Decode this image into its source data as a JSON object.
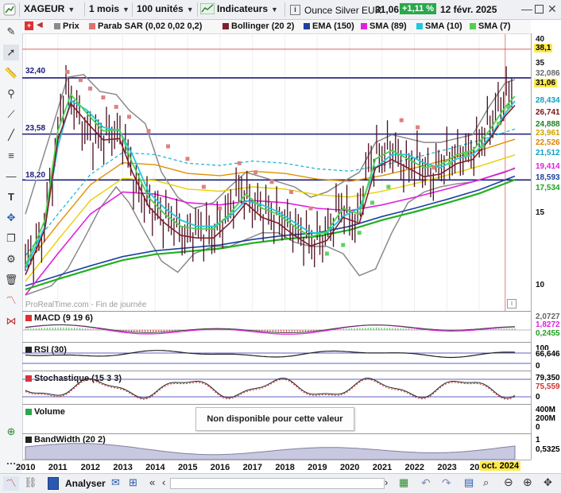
{
  "topbar": {
    "symbol": "XAGEUR",
    "period": "1 mois",
    "units": "100 unités",
    "indicators_label": "Indicateurs",
    "instrument_name": "Ounce Silver EUR",
    "last_price": "31,06",
    "change_pct": "+1,11 %",
    "date": "12 févr. 2025"
  },
  "legend": [
    {
      "label": "Prix",
      "color": "#8b8b8b"
    },
    {
      "label": "Parab SAR (0,02 0,02 0,2)",
      "color": "#e07070"
    },
    {
      "label": "Bollinger (20 2)",
      "color": "#7f1f2f"
    },
    {
      "label": "EMA (150)",
      "color": "#1f3fa0"
    },
    {
      "label": "SMA (89)",
      "color": "#e020e0"
    },
    {
      "label": "SMA (10)",
      "color": "#20c8e0"
    },
    {
      "label": "SMA (7)",
      "color": "#50d050"
    }
  ],
  "chart_data": {
    "type": "line",
    "title": "",
    "x_range": [
      2010,
      2025.1
    ],
    "y_scale": "log",
    "ylim": [
      9,
      40
    ],
    "years": [
      "2010",
      "2011",
      "2012",
      "2013",
      "2014",
      "2015",
      "2016",
      "2017",
      "2018",
      "2019",
      "2020",
      "2021",
      "2022",
      "2023",
      "2024"
    ],
    "y_ticks": [
      "40",
      "35",
      "15",
      "10"
    ],
    "price_levels": [
      {
        "label": "32,40",
        "value": 32.4,
        "color": "#1a1a7a"
      },
      {
        "label": "23,58",
        "value": 23.58,
        "color": "#1a1a7a"
      },
      {
        "label": "18,20",
        "value": 18.2,
        "color": "#1a1a7a"
      }
    ],
    "right_labels": [
      {
        "text": "38,1",
        "bg": "#ffe94d",
        "fg": "#000000"
      },
      {
        "text": "32,086",
        "bg": "#ffffff",
        "fg": "#666666"
      },
      {
        "text": "31,06",
        "bg": "#ffe94d",
        "fg": "#000000"
      },
      {
        "text": "28,434",
        "bg": "#ffffff",
        "fg": "#10a0c0"
      },
      {
        "text": "26,741",
        "bg": "#ffffff",
        "fg": "#7a1010"
      },
      {
        "text": "24,888",
        "bg": "#ffffff",
        "fg": "#208020"
      },
      {
        "text": "23,961",
        "bg": "#ffffff",
        "fg": "#d0a000"
      },
      {
        "text": "22,526",
        "bg": "#ffffff",
        "fg": "#e08000"
      },
      {
        "text": "21,512",
        "bg": "#ffffff",
        "fg": "#10a0c0"
      },
      {
        "text": "19,414",
        "bg": "#ffffff",
        "fg": "#e020e0"
      },
      {
        "text": "18,593",
        "bg": "#ffffff",
        "fg": "#1f3fa0"
      },
      {
        "text": "17,534",
        "bg": "#ffffff",
        "fg": "#20a020"
      }
    ],
    "price_close": [
      [
        2010.0,
        11.5
      ],
      [
        2010.5,
        13.0
      ],
      [
        2010.9,
        20.0
      ],
      [
        2011.2,
        31.0
      ],
      [
        2011.5,
        28.0
      ],
      [
        2011.8,
        24.5
      ],
      [
        2012.2,
        23.0
      ],
      [
        2012.6,
        24.0
      ],
      [
        2013.0,
        23.5
      ],
      [
        2013.4,
        17.5
      ],
      [
        2013.8,
        16.0
      ],
      [
        2014.2,
        15.0
      ],
      [
        2014.6,
        14.5
      ],
      [
        2014.9,
        13.2
      ],
      [
        2015.3,
        14.0
      ],
      [
        2015.8,
        13.5
      ],
      [
        2016.2,
        15.0
      ],
      [
        2016.6,
        17.5
      ],
      [
        2017.0,
        16.0
      ],
      [
        2017.5,
        15.2
      ],
      [
        2018.0,
        14.5
      ],
      [
        2018.5,
        13.5
      ],
      [
        2018.9,
        12.8
      ],
      [
        2019.3,
        13.5
      ],
      [
        2019.7,
        16.0
      ],
      [
        2020.2,
        14.0
      ],
      [
        2020.6,
        20.5
      ],
      [
        2020.9,
        21.0
      ],
      [
        2021.3,
        22.0
      ],
      [
        2021.7,
        19.5
      ],
      [
        2022.1,
        20.5
      ],
      [
        2022.5,
        18.5
      ],
      [
        2022.9,
        20.5
      ],
      [
        2023.3,
        21.0
      ],
      [
        2023.8,
        21.5
      ],
      [
        2024.2,
        24.0
      ],
      [
        2024.5,
        27.0
      ],
      [
        2024.8,
        29.5
      ],
      [
        2025.1,
        31.06
      ]
    ],
    "bollinger_upper": [
      [
        2010.0,
        15.0
      ],
      [
        2010.8,
        24.0
      ],
      [
        2011.3,
        32.5
      ],
      [
        2011.8,
        33.0
      ],
      [
        2012.3,
        30.0
      ],
      [
        2012.8,
        29.5
      ],
      [
        2013.2,
        27.0
      ],
      [
        2013.7,
        25.0
      ],
      [
        2014.2,
        19.0
      ],
      [
        2014.7,
        16.5
      ],
      [
        2015.2,
        15.5
      ],
      [
        2015.8,
        16.0
      ],
      [
        2016.3,
        17.5
      ],
      [
        2016.8,
        19.0
      ],
      [
        2017.3,
        18.5
      ],
      [
        2017.8,
        18.0
      ],
      [
        2018.3,
        17.5
      ],
      [
        2018.8,
        16.5
      ],
      [
        2019.3,
        17.0
      ],
      [
        2019.8,
        18.0
      ],
      [
        2020.3,
        19.0
      ],
      [
        2020.8,
        22.5
      ],
      [
        2021.3,
        23.5
      ],
      [
        2021.8,
        23.0
      ],
      [
        2022.3,
        22.5
      ],
      [
        2022.8,
        22.5
      ],
      [
        2023.3,
        23.0
      ],
      [
        2023.8,
        23.5
      ],
      [
        2024.3,
        27.5
      ],
      [
        2024.8,
        31.5
      ],
      [
        2025.1,
        32.08
      ]
    ],
    "bollinger_lower": [
      [
        2010.0,
        9.5
      ],
      [
        2010.8,
        10.0
      ],
      [
        2011.3,
        11.0
      ],
      [
        2011.8,
        13.0
      ],
      [
        2012.3,
        15.5
      ],
      [
        2012.8,
        17.5
      ],
      [
        2013.2,
        16.0
      ],
      [
        2013.7,
        13.5
      ],
      [
        2014.2,
        11.5
      ],
      [
        2014.7,
        10.8
      ],
      [
        2015.2,
        12.0
      ],
      [
        2015.8,
        12.5
      ],
      [
        2016.3,
        12.5
      ],
      [
        2016.8,
        13.0
      ],
      [
        2017.3,
        13.5
      ],
      [
        2017.8,
        13.5
      ],
      [
        2018.3,
        12.8
      ],
      [
        2018.8,
        12.5
      ],
      [
        2019.3,
        12.5
      ],
      [
        2019.8,
        12.0
      ],
      [
        2020.3,
        10.6
      ],
      [
        2020.8,
        11.0
      ],
      [
        2021.3,
        13.5
      ],
      [
        2021.8,
        16.0
      ],
      [
        2022.3,
        17.0
      ],
      [
        2022.8,
        17.5
      ],
      [
        2023.3,
        17.8
      ],
      [
        2023.8,
        18.0
      ],
      [
        2024.3,
        18.5
      ],
      [
        2024.8,
        19.0
      ],
      [
        2025.1,
        19.5
      ]
    ],
    "ema150": [
      [
        2010.0,
        10.0
      ],
      [
        2011.0,
        10.6
      ],
      [
        2012.0,
        11.2
      ],
      [
        2013.0,
        11.8
      ],
      [
        2014.0,
        12.2
      ],
      [
        2015.0,
        12.4
      ],
      [
        2016.0,
        12.6
      ],
      [
        2017.0,
        13.0
      ],
      [
        2018.0,
        13.3
      ],
      [
        2019.0,
        13.5
      ],
      [
        2020.0,
        14.0
      ],
      [
        2021.0,
        14.8
      ],
      [
        2022.0,
        15.5
      ],
      [
        2023.0,
        16.3
      ],
      [
        2024.0,
        17.2
      ],
      [
        2025.1,
        18.59
      ]
    ],
    "sma89": [
      [
        2010.0,
        9.5
      ],
      [
        2011.0,
        12.0
      ],
      [
        2012.0,
        15.0
      ],
      [
        2013.0,
        17.0
      ],
      [
        2014.0,
        16.8
      ],
      [
        2015.0,
        16.0
      ],
      [
        2016.0,
        15.8
      ],
      [
        2017.0,
        16.2
      ],
      [
        2018.0,
        16.0
      ],
      [
        2019.0,
        15.5
      ],
      [
        2020.0,
        15.3
      ],
      [
        2021.0,
        15.8
      ],
      [
        2022.0,
        16.5
      ],
      [
        2023.0,
        17.3
      ],
      [
        2024.0,
        18.2
      ],
      [
        2025.1,
        19.41
      ]
    ],
    "sma10": [
      [
        2010.0,
        11.0
      ],
      [
        2010.6,
        14.0
      ],
      [
        2011.0,
        22.0
      ],
      [
        2011.4,
        28.5
      ],
      [
        2011.9,
        27.0
      ],
      [
        2012.4,
        24.5
      ],
      [
        2012.9,
        24.0
      ],
      [
        2013.3,
        21.0
      ],
      [
        2013.8,
        17.0
      ],
      [
        2014.3,
        15.5
      ],
      [
        2014.8,
        14.5
      ],
      [
        2015.3,
        14.0
      ],
      [
        2015.8,
        14.0
      ],
      [
        2016.3,
        14.8
      ],
      [
        2016.8,
        16.2
      ],
      [
        2017.3,
        15.8
      ],
      [
        2017.8,
        15.2
      ],
      [
        2018.3,
        14.3
      ],
      [
        2018.8,
        13.5
      ],
      [
        2019.3,
        13.5
      ],
      [
        2019.8,
        14.8
      ],
      [
        2020.3,
        15.5
      ],
      [
        2020.8,
        19.5
      ],
      [
        2021.3,
        21.0
      ],
      [
        2021.8,
        21.0
      ],
      [
        2022.3,
        20.0
      ],
      [
        2022.8,
        19.5
      ],
      [
        2023.3,
        20.5
      ],
      [
        2023.8,
        21.0
      ],
      [
        2024.3,
        23.0
      ],
      [
        2024.8,
        26.5
      ],
      [
        2025.1,
        28.43
      ]
    ],
    "sma7": [
      [
        2010.0,
        11.2
      ],
      [
        2010.6,
        14.5
      ],
      [
        2011.0,
        24.0
      ],
      [
        2011.4,
        29.5
      ],
      [
        2011.9,
        26.5
      ],
      [
        2012.4,
        24.0
      ],
      [
        2012.9,
        24.2
      ],
      [
        2013.3,
        20.0
      ],
      [
        2013.8,
        16.5
      ],
      [
        2014.3,
        15.0
      ],
      [
        2014.8,
        14.0
      ],
      [
        2015.3,
        13.8
      ],
      [
        2015.8,
        13.8
      ],
      [
        2016.3,
        15.0
      ],
      [
        2016.8,
        16.8
      ],
      [
        2017.3,
        15.5
      ],
      [
        2017.8,
        15.0
      ],
      [
        2018.3,
        14.0
      ],
      [
        2018.8,
        13.2
      ],
      [
        2019.3,
        13.6
      ],
      [
        2019.8,
        15.5
      ],
      [
        2020.3,
        15.0
      ],
      [
        2020.8,
        20.5
      ],
      [
        2021.3,
        21.5
      ],
      [
        2021.8,
        20.5
      ],
      [
        2022.3,
        19.5
      ],
      [
        2022.8,
        19.8
      ],
      [
        2023.3,
        21.0
      ],
      [
        2023.8,
        21.5
      ],
      [
        2024.3,
        24.0
      ],
      [
        2024.8,
        27.5
      ],
      [
        2025.1,
        29.2
      ]
    ],
    "sar_points": [
      [
        2011.3,
        33.5
      ],
      [
        2011.7,
        32.0
      ],
      [
        2012.0,
        30.5
      ],
      [
        2012.4,
        29.0
      ],
      [
        2012.8,
        27.5
      ],
      [
        2013.2,
        26.0
      ],
      [
        2013.8,
        24.0
      ],
      [
        2014.4,
        22.0
      ],
      [
        2015.0,
        20.5
      ],
      [
        2015.5,
        17.5
      ],
      [
        2016.0,
        15.5
      ],
      [
        2016.6,
        20.0
      ],
      [
        2017.1,
        19.0
      ],
      [
        2017.6,
        18.0
      ],
      [
        2018.2,
        17.0
      ],
      [
        2018.8,
        15.5
      ],
      [
        2019.3,
        12.0
      ],
      [
        2019.8,
        12.6
      ],
      [
        2020.3,
        13.5
      ],
      [
        2020.7,
        16.0
      ],
      [
        2021.2,
        17.5
      ],
      [
        2021.6,
        25.5
      ],
      [
        2022.1,
        24.5
      ],
      [
        2022.6,
        19.5
      ],
      [
        2023.1,
        20.0
      ],
      [
        2023.6,
        21.0
      ],
      [
        2024.1,
        22.0
      ],
      [
        2024.6,
        25.0
      ],
      [
        2024.9,
        27.5
      ]
    ],
    "panels": [
      {
        "name": "MACD (9 19 6)",
        "labels": [
          {
            "text": "2,0727",
            "fg": "#666666"
          },
          {
            "text": "1,8272",
            "fg": "#e020e0"
          },
          {
            "text": "0,2455",
            "fg": "#20a020"
          }
        ]
      },
      {
        "name": "RSI (30)",
        "labels": [
          {
            "text": "100",
            "fg": "#000000"
          },
          {
            "text": "66,646",
            "fg": "#000000"
          },
          {
            "text": "0",
            "fg": "#000000"
          }
        ]
      },
      {
        "name": "Stochastique (15 3 3)",
        "labels": [
          {
            "text": "79,350",
            "fg": "#000000"
          },
          {
            "text": "75,559",
            "fg": "#d03030"
          },
          {
            "text": "0",
            "fg": "#000000"
          }
        ]
      },
      {
        "name": "Volume",
        "labels": [
          {
            "text": "400M",
            "fg": "#000000"
          },
          {
            "text": "200M",
            "fg": "#000000"
          },
          {
            "text": "0",
            "fg": "#000000"
          }
        ]
      },
      {
        "name": "BandWidth (20 2)",
        "labels": [
          {
            "text": "1",
            "fg": "#000000"
          },
          {
            "text": "0,5325",
            "fg": "#000000"
          }
        ]
      }
    ]
  },
  "watermark": "ProRealTime.com - Fin de journée",
  "volume_message": "Non disponible pour cette valeur",
  "cursor_date_label": "oct. 2024",
  "bottombar": {
    "analyser_label": "Analyser"
  },
  "colors": {
    "accent": "#1a1a7a",
    "highlight": "#ffe94d",
    "up": "#20a040"
  }
}
